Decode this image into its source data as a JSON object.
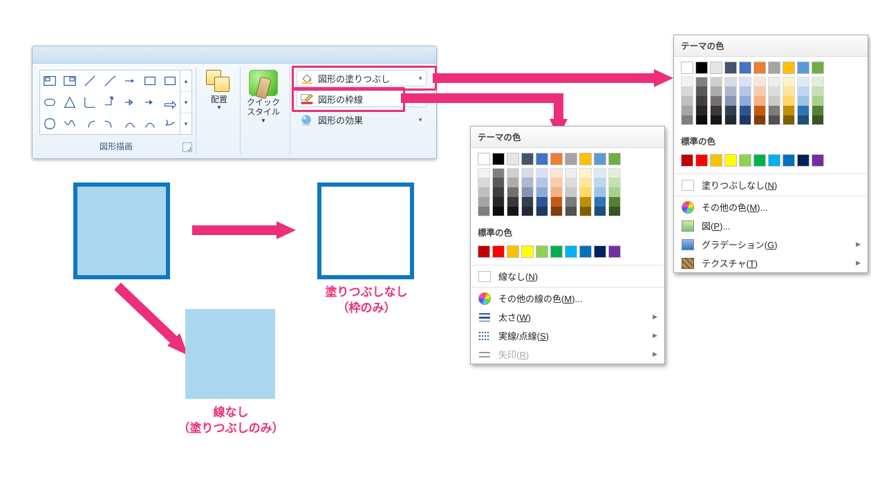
{
  "ribbon": {
    "group_label": "図形描画",
    "arrange": "配置",
    "quick_style_l1": "クイック",
    "quick_style_l2": "スタイル",
    "fill": "図形の塗りつぶし",
    "outline": "図形の枠線",
    "effects": "図形の効果"
  },
  "examples": {
    "outline_only_l1": "塗りつぶしなし",
    "outline_only_l2": "（枠のみ）",
    "fill_only_l1": "線なし",
    "fill_only_l2": "（塗りつぶしのみ）"
  },
  "picker_outline": {
    "theme": "テーマの色",
    "standard": "標準の色",
    "none": "線なし(N)",
    "more": "その他の線の色(M)...",
    "weight": "太さ(W)",
    "dash": "実線/点線(S)",
    "arrows": "矢印(R)"
  },
  "picker_fill": {
    "theme": "テーマの色",
    "standard": "標準の色",
    "none": "塗りつぶしなし(N)",
    "more": "その他の色(M)...",
    "picture": "図(P)...",
    "gradient": "グラデーション(G)",
    "texture": "テクスチャ(T)"
  },
  "theme_colors": [
    "#ffffff",
    "#000000",
    "#e7e6e6",
    "#44546a",
    "#4472c4",
    "#ed7d31",
    "#a5a5a5",
    "#ffc000",
    "#5b9bd5",
    "#70ad47"
  ],
  "theme_shades": [
    [
      "#f2f2f2",
      "#7f7f7f",
      "#d0cece",
      "#d6dce4",
      "#d9e2f3",
      "#fbe5d5",
      "#ededed",
      "#fff2cc",
      "#deebf6",
      "#e2efd9"
    ],
    [
      "#d8d8d8",
      "#595959",
      "#aeabab",
      "#adb9ca",
      "#b4c6e7",
      "#f7cbac",
      "#dbdbdb",
      "#fee599",
      "#bdd7ee",
      "#c5e0b3"
    ],
    [
      "#bfbfbf",
      "#3f3f3f",
      "#757070",
      "#8496b0",
      "#8eaadb",
      "#f4b183",
      "#c9c9c9",
      "#ffd965",
      "#9cc3e5",
      "#a8d08d"
    ],
    [
      "#a5a5a5",
      "#262626",
      "#3a3838",
      "#323f4f",
      "#2f5496",
      "#c55a11",
      "#7b7b7b",
      "#bf9000",
      "#2e75b5",
      "#538135"
    ],
    [
      "#7f7f7f",
      "#0c0c0c",
      "#171616",
      "#222a35",
      "#1f3864",
      "#833c0b",
      "#525252",
      "#7f6000",
      "#1e4e79",
      "#375623"
    ]
  ],
  "standard_colors": [
    "#c00000",
    "#ff0000",
    "#ffc000",
    "#ffff00",
    "#92d050",
    "#00b050",
    "#00b0f0",
    "#0070c0",
    "#002060",
    "#7030a0"
  ]
}
